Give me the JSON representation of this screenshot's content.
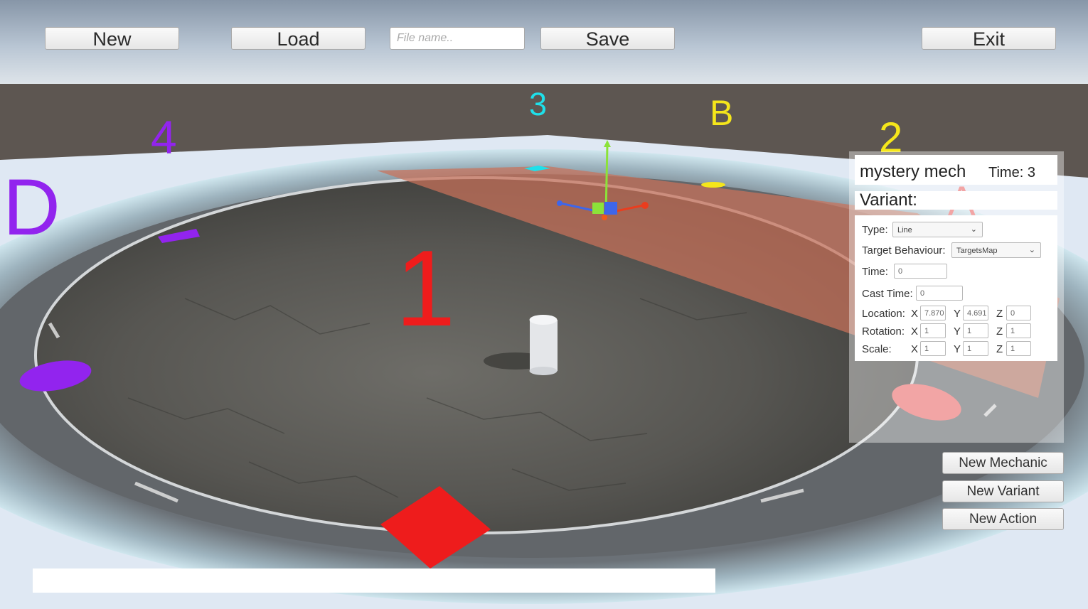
{
  "toolbar": {
    "new_label": "New",
    "load_label": "Load",
    "file_placeholder": "File name..",
    "save_label": "Save",
    "exit_label": "Exit"
  },
  "scene_markers": {
    "one": "1",
    "two": "2",
    "three": "3",
    "four": "4",
    "a": "A",
    "b": "B",
    "d": "D"
  },
  "marker_colors": {
    "red": "#ef1c1c",
    "yellow": "#f5e61b",
    "cyan": "#1ee0ea",
    "purple": "#9224ee"
  },
  "mechanic_panel": {
    "name": "mystery mech",
    "time_label": "Time: 3",
    "variant_label": "Variant:",
    "type_label": "Type:",
    "type_value": "Line",
    "target_behaviour_label": "Target Behaviour:",
    "target_behaviour_value": "TargetsMap",
    "time_field_label": "Time:",
    "time_value": "0",
    "cast_time_label": "Cast Time:",
    "cast_time_value": "0",
    "location_label": "Location:",
    "location": {
      "x": "7.870",
      "y": "4.691",
      "z": "0"
    },
    "rotation_label": "Rotation:",
    "rotation": {
      "x": "1",
      "y": "1",
      "z": "1"
    },
    "scale_label": "Scale:",
    "scale": {
      "x": "1",
      "y": "1",
      "z": "1"
    },
    "axis_x": "X",
    "axis_y": "Y",
    "axis_z": "Z"
  },
  "side_buttons": {
    "new_mechanic": "New Mechanic",
    "new_variant": "New Variant",
    "new_action": "New Action"
  },
  "icons": {
    "dropdown": "chevron-down-icon",
    "gizmo": "transform-gizmo-icon"
  }
}
